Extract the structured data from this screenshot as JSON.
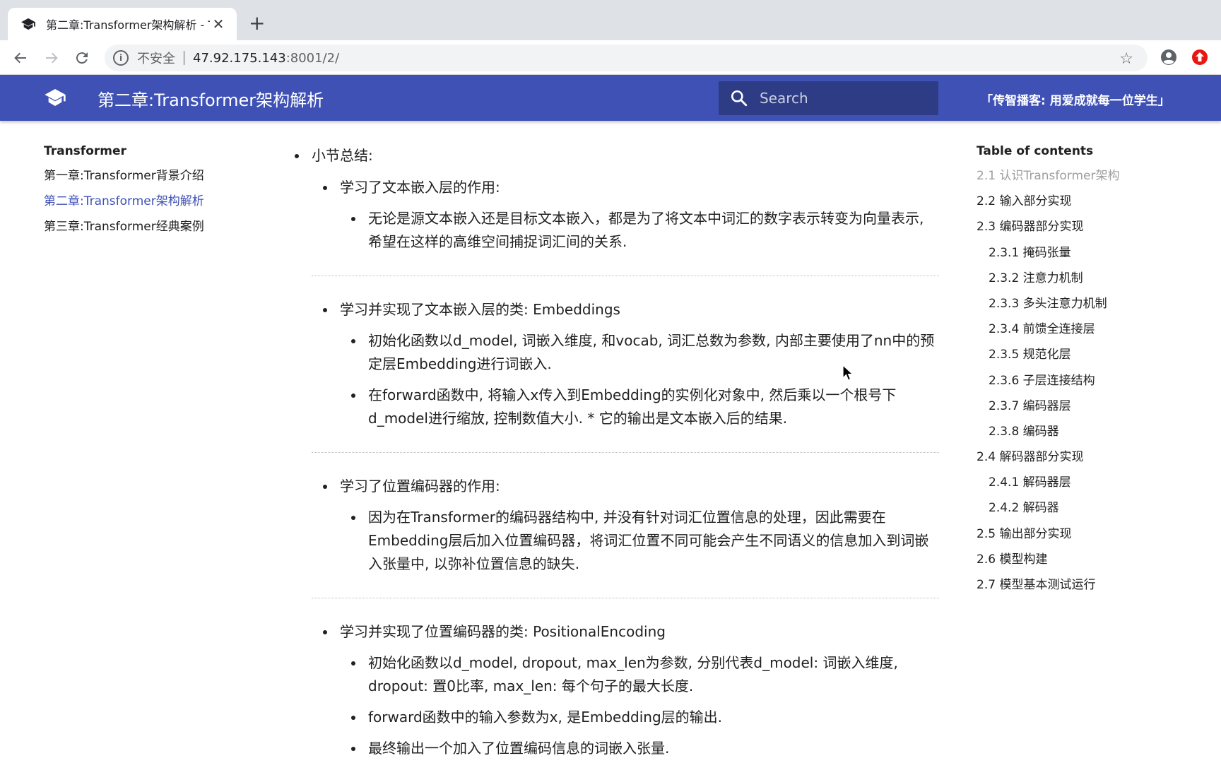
{
  "browser": {
    "tab_title": "第二章:Transformer架构解析 - T",
    "new_tab_label": "+",
    "close_label": "✕",
    "insecure_label": "不安全",
    "url_host": "47.92.175.143",
    "url_rest": ":8001/2/"
  },
  "header": {
    "title": "第二章:Transformer架构解析",
    "search_placeholder": "Search",
    "slogan": "「传智播客: 用爱成就每一位学生」"
  },
  "leftnav": {
    "title": "Transformer",
    "items": [
      {
        "label": "第一章:Transformer背景介绍",
        "active": false
      },
      {
        "label": "第二章:Transformer架构解析",
        "active": true
      },
      {
        "label": "第三章:Transformer经典案例",
        "active": false
      }
    ]
  },
  "content": {
    "summary_label": "小节总结:",
    "s1": {
      "heading": "学习了文本嵌入层的作用:",
      "points": [
        "无论是源文本嵌入还是目标文本嵌入，都是为了将文本中词汇的数字表示转变为向量表示, 希望在这样的高维空间捕捉词汇间的关系."
      ]
    },
    "s2": {
      "heading": "学习并实现了文本嵌入层的类: Embeddings",
      "points": [
        "初始化函数以d_model, 词嵌入维度, 和vocab, 词汇总数为参数, 内部主要使用了nn中的预定层Embedding进行词嵌入.",
        "在forward函数中, 将输入x传入到Embedding的实例化对象中, 然后乘以一个根号下d_model进行缩放, 控制数值大小. * 它的输出是文本嵌入后的结果."
      ]
    },
    "s3": {
      "heading": "学习了位置编码器的作用:",
      "points": [
        "因为在Transformer的编码器结构中, 并没有针对词汇位置信息的处理，因此需要在Embedding层后加入位置编码器，将词汇位置不同可能会产生不同语义的信息加入到词嵌入张量中, 以弥补位置信息的缺失."
      ]
    },
    "s4": {
      "heading": "学习并实现了位置编码器的类: PositionalEncoding",
      "points": [
        "初始化函数以d_model, dropout, max_len为参数, 分别代表d_model: 词嵌入维度, dropout: 置0比率, max_len: 每个句子的最大长度.",
        "forward函数中的输入参数为x, 是Embedding层的输出.",
        "最终输出一个加入了位置编码信息的词嵌入张量."
      ]
    }
  },
  "toc": {
    "title": "Table of contents",
    "items": [
      {
        "label": "2.1 认识Transformer架构",
        "active": true,
        "sub": false
      },
      {
        "label": "2.2 输入部分实现",
        "active": false,
        "sub": false
      },
      {
        "label": "2.3 编码器部分实现",
        "active": false,
        "sub": false
      },
      {
        "label": "2.3.1 掩码张量",
        "active": false,
        "sub": true
      },
      {
        "label": "2.3.2 注意力机制",
        "active": false,
        "sub": true
      },
      {
        "label": "2.3.3 多头注意力机制",
        "active": false,
        "sub": true
      },
      {
        "label": "2.3.4 前馈全连接层",
        "active": false,
        "sub": true
      },
      {
        "label": "2.3.5 规范化层",
        "active": false,
        "sub": true
      },
      {
        "label": "2.3.6 子层连接结构",
        "active": false,
        "sub": true
      },
      {
        "label": "2.3.7 编码器层",
        "active": false,
        "sub": true
      },
      {
        "label": "2.3.8 编码器",
        "active": false,
        "sub": true
      },
      {
        "label": "2.4 解码器部分实现",
        "active": false,
        "sub": false
      },
      {
        "label": "2.4.1 解码器层",
        "active": false,
        "sub": true
      },
      {
        "label": "2.4.2 解码器",
        "active": false,
        "sub": true
      },
      {
        "label": "2.5 输出部分实现",
        "active": false,
        "sub": false
      },
      {
        "label": "2.6 模型构建",
        "active": false,
        "sub": false
      },
      {
        "label": "2.7 模型基本测试运行",
        "active": false,
        "sub": false
      }
    ]
  },
  "colors": {
    "header_bg": "#3f51b5",
    "link_active": "#3f51b5",
    "toc_active": "#9e9e9e"
  },
  "icons": {
    "favicon": "graduation-cap-icon",
    "back": "arrow-left-icon",
    "forward": "arrow-right-icon",
    "reload": "reload-icon",
    "info": "info-icon",
    "star": "star-icon",
    "profile": "account-circle-icon",
    "extension": "extension-icon",
    "logo": "graduation-cap-icon",
    "search": "search-icon"
  }
}
